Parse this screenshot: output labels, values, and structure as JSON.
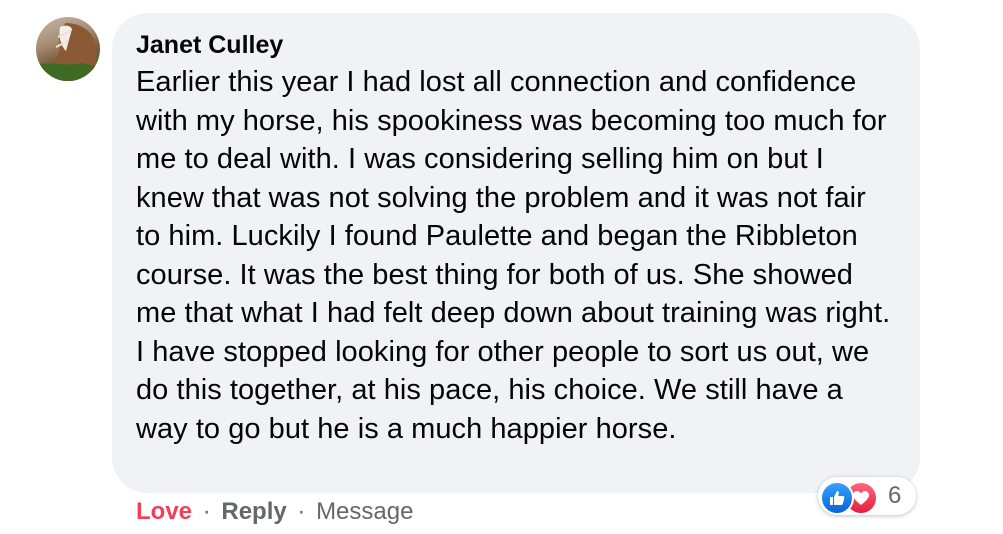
{
  "comment": {
    "author": "Janet Culley",
    "text": "Earlier this year I had lost all connection and confidence with my horse, his spookiness was becoming too much for me to deal with. I was considering selling him on but I knew that was not solving the problem and it was not fair to him. Luckily I found Paulette and began the Ribbleton course. It was the best thing for both of us. She showed me that what I had felt deep down about training was right. I have stopped looking for other people to sort us out, we do this together, at his pace, his choice. We still have a way to go but he is a much happier horse."
  },
  "reactions": {
    "icons": [
      "like-icon",
      "love-icon"
    ],
    "count": "6"
  },
  "actions": {
    "love_label": "Love",
    "reply_label": "Reply",
    "message_label": "Message",
    "separator": "·"
  },
  "colors": {
    "bubble": "#f0f2f5",
    "love_active": "#f33e58",
    "muted": "#65676b",
    "like_blue": "#0866d6",
    "love_red": "#e61e3e"
  }
}
